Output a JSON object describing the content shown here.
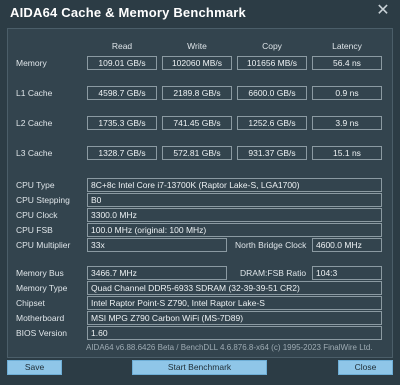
{
  "window": {
    "title": "AIDA64 Cache & Memory Benchmark",
    "close_icon": "close-icon"
  },
  "table": {
    "headers": {
      "read": "Read",
      "write": "Write",
      "copy": "Copy",
      "latency": "Latency"
    },
    "rows": [
      {
        "label": "Memory",
        "read": "109.01 GB/s",
        "write": "102060 MB/s",
        "copy": "101656 MB/s",
        "latency": "56.4 ns"
      },
      {
        "label": "L1 Cache",
        "read": "4598.7 GB/s",
        "write": "2189.8 GB/s",
        "copy": "6600.0 GB/s",
        "latency": "0.9 ns"
      },
      {
        "label": "L2 Cache",
        "read": "1735.3 GB/s",
        "write": "741.45 GB/s",
        "copy": "1252.6 GB/s",
        "latency": "3.9 ns"
      },
      {
        "label": "L3 Cache",
        "read": "1328.7 GB/s",
        "write": "572.81 GB/s",
        "copy": "931.37 GB/s",
        "latency": "15.1 ns"
      }
    ]
  },
  "cpu": {
    "type_label": "CPU Type",
    "type_value": "8C+8c Intel Core i7-13700K  (Raptor Lake-S, LGA1700)",
    "stepping_label": "CPU Stepping",
    "stepping_value": "B0",
    "clock_label": "CPU Clock",
    "clock_value": "3300.0 MHz",
    "fsb_label": "CPU FSB",
    "fsb_value": "100.0 MHz  (original: 100 MHz)",
    "multiplier_label": "CPU Multiplier",
    "multiplier_value": "33x",
    "nb_clock_label": "North Bridge Clock",
    "nb_clock_value": "4600.0 MHz"
  },
  "system": {
    "memory_bus_label": "Memory Bus",
    "memory_bus_value": "3466.7 MHz",
    "dram_fsb_label": "DRAM:FSB Ratio",
    "dram_fsb_value": "104:3",
    "memory_type_label": "Memory Type",
    "memory_type_value": "Quad Channel DDR5-6933 SDRAM  (32-39-39-51 CR2)",
    "chipset_label": "Chipset",
    "chipset_value": "Intel Raptor Point-S Z790, Intel Raptor Lake-S",
    "motherboard_label": "Motherboard",
    "motherboard_value": "MSI MPG Z790 Carbon WiFi (MS-7D89)",
    "bios_label": "BIOS Version",
    "bios_value": "1.60"
  },
  "footer": {
    "text": "AIDA64 v6.88.6426 Beta / BenchDLL 4.6.876.8-x64  (c) 1995-2023 FinalWire Ltd."
  },
  "buttons": {
    "save": "Save",
    "start": "Start Benchmark",
    "close": "Close"
  },
  "colors": {
    "background": "#2c3c45",
    "panel": "#33444e",
    "button": "#8fc6e8"
  }
}
